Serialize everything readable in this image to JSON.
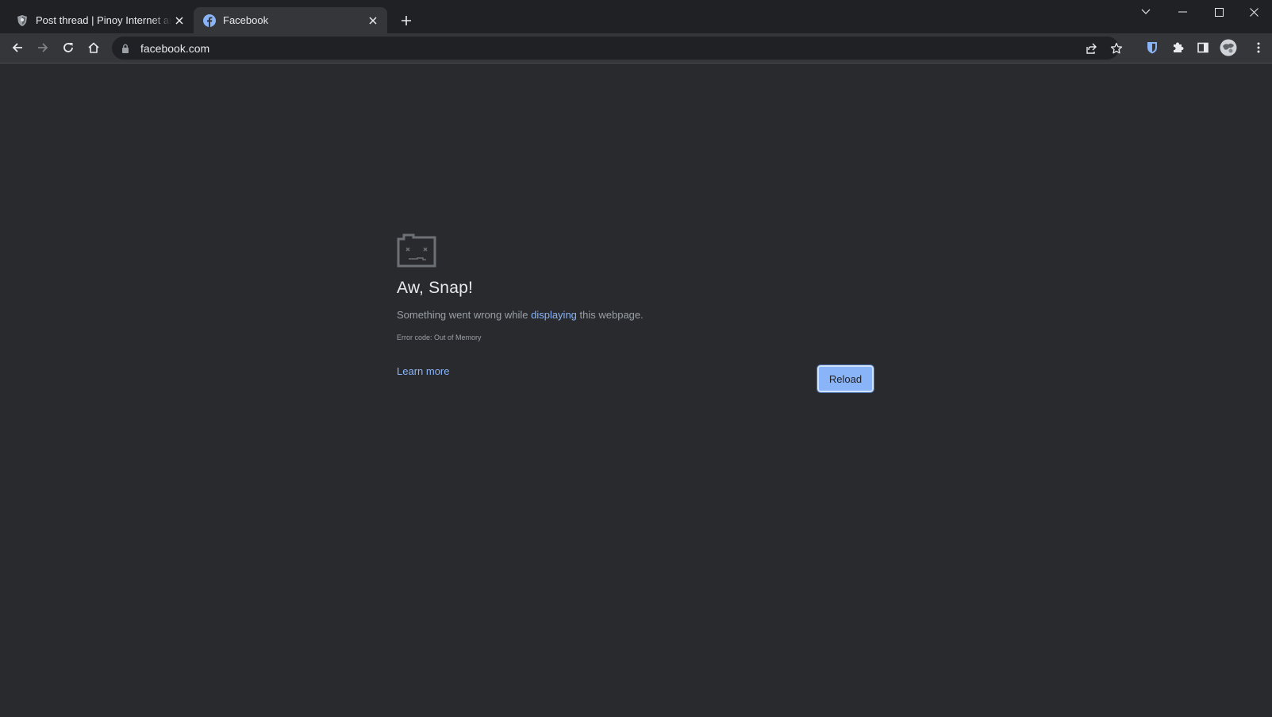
{
  "tabs": [
    {
      "title": "Post thread | Pinoy Internet and Technology Forums",
      "favicon": "shield-icon",
      "active": false
    },
    {
      "title": "Facebook",
      "favicon": "facebook-icon",
      "active": true
    }
  ],
  "omnibox": {
    "url": "facebook.com"
  },
  "error_page": {
    "icon": "sad-tab-icon",
    "heading": "Aw, Snap!",
    "message_parts": [
      "Something went wrong while ",
      "displaying",
      " this webpage."
    ],
    "error_code": "Error code: Out of Memory",
    "learn_more": "Learn more",
    "reload": "Reload"
  },
  "colors": {
    "frame": "#202124",
    "toolbar": "#35363a",
    "content": "#292a2d",
    "link": "#8ab4f8",
    "button": "#8ab4f8"
  }
}
